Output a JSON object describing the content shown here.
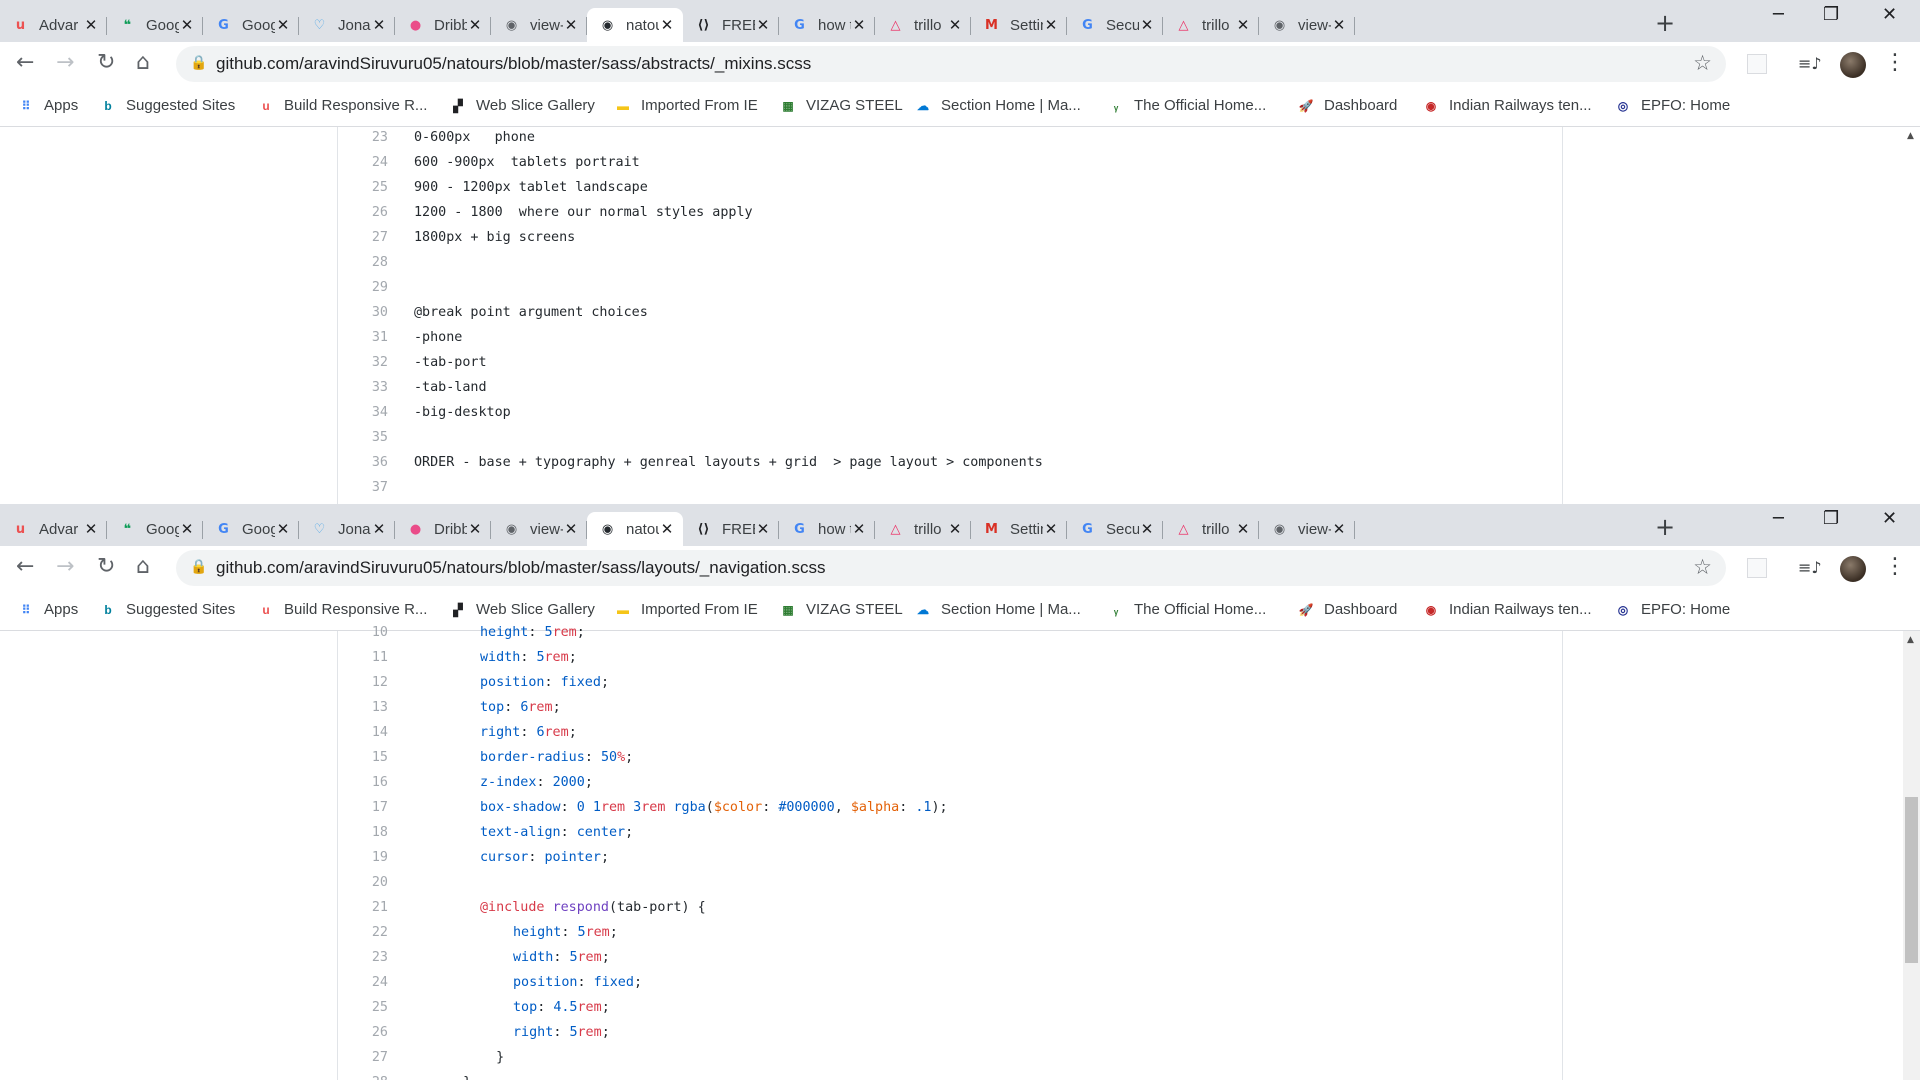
{
  "tabs": [
    {
      "title": "Advar",
      "icon": "udemy-icon",
      "color": "#ec5252"
    },
    {
      "title": "Goog",
      "icon": "google-hangouts-icon",
      "color": "#0f9d58"
    },
    {
      "title": "Goog",
      "icon": "google-icon",
      "color": "#4285f4"
    },
    {
      "title": "Jonas",
      "icon": "heart-icon",
      "color": "#4ba6e8"
    },
    {
      "title": "Dribb",
      "icon": "dribbble-icon",
      "color": "#ea4c89"
    },
    {
      "title": "view-",
      "icon": "globe-icon",
      "color": "#5f6368"
    },
    {
      "title": "natou",
      "icon": "github-icon",
      "color": "#24292e"
    },
    {
      "title": "FREE",
      "icon": "code-icon",
      "color": "#202124"
    },
    {
      "title": "how t",
      "icon": "google-icon",
      "color": "#4285f4"
    },
    {
      "title": "trillo",
      "icon": "triangle-icon",
      "color": "#eb2f64"
    },
    {
      "title": "Settin",
      "icon": "gmail-icon",
      "color": "#d93025"
    },
    {
      "title": "Secur",
      "icon": "google-icon",
      "color": "#4285f4"
    },
    {
      "title": "trillo",
      "icon": "triangle-icon",
      "color": "#eb2f64"
    },
    {
      "title": "view-",
      "icon": "globe-icon",
      "color": "#5f6368"
    }
  ],
  "bookmarks": [
    {
      "label": "Apps",
      "icon": "apps-grid-icon"
    },
    {
      "label": "Suggested Sites",
      "icon": "bing-icon"
    },
    {
      "label": "Build Responsive R...",
      "icon": "udemy-icon"
    },
    {
      "label": "Web Slice Gallery",
      "icon": "web-slice-icon"
    },
    {
      "label": "Imported From IE",
      "icon": "folder-icon"
    },
    {
      "label": "VIZAG STEEL",
      "icon": "vizag-steel-icon"
    },
    {
      "label": "Section Home | Ma...",
      "icon": "section-home-icon"
    },
    {
      "label": "The Official Home...",
      "icon": "official-home-icon"
    },
    {
      "label": "Dashboard",
      "icon": "dashboard-icon"
    },
    {
      "label": "Indian Railways ten...",
      "icon": "indian-railways-icon"
    },
    {
      "label": "EPFO: Home",
      "icon": "epfo-icon"
    }
  ],
  "window1": {
    "url": "github.com/aravindSiruvuru05/natours/blob/master/sass/abstracts/_mixins.scss",
    "lines": [
      {
        "n": "23",
        "text": "0-600px   phone"
      },
      {
        "n": "24",
        "text": "600 -900px  tablets portrait"
      },
      {
        "n": "25",
        "text": "900 - 1200px tablet landscape"
      },
      {
        "n": "26",
        "text": "1200 - 1800  where our normal styles apply"
      },
      {
        "n": "27",
        "text": "1800px + big screens"
      },
      {
        "n": "28",
        "text": ""
      },
      {
        "n": "29",
        "text": ""
      },
      {
        "n": "30",
        "text": "@break point argument choices"
      },
      {
        "n": "31",
        "text": "-phone"
      },
      {
        "n": "32",
        "text": "-tab-port"
      },
      {
        "n": "33",
        "text": "-tab-land"
      },
      {
        "n": "34",
        "text": "-big-desktop"
      },
      {
        "n": "35",
        "text": ""
      },
      {
        "n": "36",
        "text": "ORDER - base + typography + genreal layouts + grid  > page layout > components"
      },
      {
        "n": "37",
        "text": ""
      }
    ]
  },
  "window2": {
    "url": "github.com/aravindSiruvuru05/natours/blob/master/sass/layouts/_navigation.scss",
    "lines": [
      {
        "n": "10",
        "indent": 2,
        "tokens": [
          [
            "p",
            "height"
          ],
          [
            "v",
            ": "
          ],
          [
            "num",
            "5"
          ],
          [
            "u",
            "rem"
          ],
          [
            "v",
            ";"
          ]
        ]
      },
      {
        "n": "11",
        "indent": 2,
        "tokens": [
          [
            "p",
            "width"
          ],
          [
            "v",
            ": "
          ],
          [
            "num",
            "5"
          ],
          [
            "u",
            "rem"
          ],
          [
            "v",
            ";"
          ]
        ]
      },
      {
        "n": "12",
        "indent": 2,
        "tokens": [
          [
            "p",
            "position"
          ],
          [
            "v",
            ": "
          ],
          [
            "num",
            "fixed"
          ],
          [
            "v",
            ";"
          ]
        ]
      },
      {
        "n": "13",
        "indent": 2,
        "tokens": [
          [
            "p",
            "top"
          ],
          [
            "v",
            ": "
          ],
          [
            "num",
            "6"
          ],
          [
            "u",
            "rem"
          ],
          [
            "v",
            ";"
          ]
        ]
      },
      {
        "n": "14",
        "indent": 2,
        "tokens": [
          [
            "p",
            "right"
          ],
          [
            "v",
            ": "
          ],
          [
            "num",
            "6"
          ],
          [
            "u",
            "rem"
          ],
          [
            "v",
            ";"
          ]
        ]
      },
      {
        "n": "15",
        "indent": 2,
        "tokens": [
          [
            "p",
            "border-radius"
          ],
          [
            "v",
            ": "
          ],
          [
            "num",
            "50"
          ],
          [
            "u",
            "%"
          ],
          [
            "v",
            ";"
          ]
        ]
      },
      {
        "n": "16",
        "indent": 2,
        "tokens": [
          [
            "p",
            "z-index"
          ],
          [
            "v",
            ": "
          ],
          [
            "num",
            "2000"
          ],
          [
            "v",
            ";"
          ]
        ]
      },
      {
        "n": "17",
        "indent": 2,
        "tokens": [
          [
            "p",
            "box-shadow"
          ],
          [
            "v",
            ": "
          ],
          [
            "num",
            "0 1"
          ],
          [
            "u",
            "rem"
          ],
          [
            "num",
            " 3"
          ],
          [
            "u",
            "rem"
          ],
          [
            "v",
            " "
          ],
          [
            "p",
            "rgba"
          ],
          [
            "v",
            "("
          ],
          [
            "var",
            "$color"
          ],
          [
            "v",
            ": "
          ],
          [
            "num",
            "#000000"
          ],
          [
            "v",
            ", "
          ],
          [
            "var",
            "$alpha"
          ],
          [
            "v",
            ": "
          ],
          [
            "num",
            ".1"
          ],
          [
            "v",
            ");"
          ]
        ]
      },
      {
        "n": "18",
        "indent": 2,
        "tokens": [
          [
            "p",
            "text-align"
          ],
          [
            "v",
            ": "
          ],
          [
            "num",
            "center"
          ],
          [
            "v",
            ";"
          ]
        ]
      },
      {
        "n": "19",
        "indent": 2,
        "tokens": [
          [
            "p",
            "cursor"
          ],
          [
            "v",
            ": "
          ],
          [
            "num",
            "pointer"
          ],
          [
            "v",
            ";"
          ]
        ]
      },
      {
        "n": "20",
        "indent": 0,
        "tokens": []
      },
      {
        "n": "21",
        "indent": 2,
        "tokens": [
          [
            "at",
            "@include"
          ],
          [
            "v",
            " "
          ],
          [
            "fn",
            "respond"
          ],
          [
            "v",
            "(tab-port) {"
          ]
        ]
      },
      {
        "n": "22",
        "indent": 3,
        "tokens": [
          [
            "p",
            "height"
          ],
          [
            "v",
            ": "
          ],
          [
            "num",
            "5"
          ],
          [
            "u",
            "rem"
          ],
          [
            "v",
            ";"
          ]
        ]
      },
      {
        "n": "23",
        "indent": 3,
        "tokens": [
          [
            "p",
            "width"
          ],
          [
            "v",
            ": "
          ],
          [
            "num",
            "5"
          ],
          [
            "u",
            "rem"
          ],
          [
            "v",
            ";"
          ]
        ]
      },
      {
        "n": "24",
        "indent": 3,
        "tokens": [
          [
            "p",
            "position"
          ],
          [
            "v",
            ": "
          ],
          [
            "num",
            "fixed"
          ],
          [
            "v",
            ";"
          ]
        ]
      },
      {
        "n": "25",
        "indent": 3,
        "tokens": [
          [
            "p",
            "top"
          ],
          [
            "v",
            ": "
          ],
          [
            "num",
            "4.5"
          ],
          [
            "u",
            "rem"
          ],
          [
            "v",
            ";"
          ]
        ]
      },
      {
        "n": "26",
        "indent": 3,
        "tokens": [
          [
            "p",
            "right"
          ],
          [
            "v",
            ": "
          ],
          [
            "num",
            "5"
          ],
          [
            "u",
            "rem"
          ],
          [
            "v",
            ";"
          ]
        ]
      },
      {
        "n": "27",
        "indent": 2,
        "tokens": [
          [
            "v",
            "  }"
          ]
        ]
      },
      {
        "n": "28",
        "indent": 1,
        "tokens": [
          [
            "v",
            "  }"
          ]
        ]
      }
    ]
  },
  "scrollbar2": {
    "thumb_top_fraction": 0.37,
    "thumb_size_fraction": 0.37
  }
}
